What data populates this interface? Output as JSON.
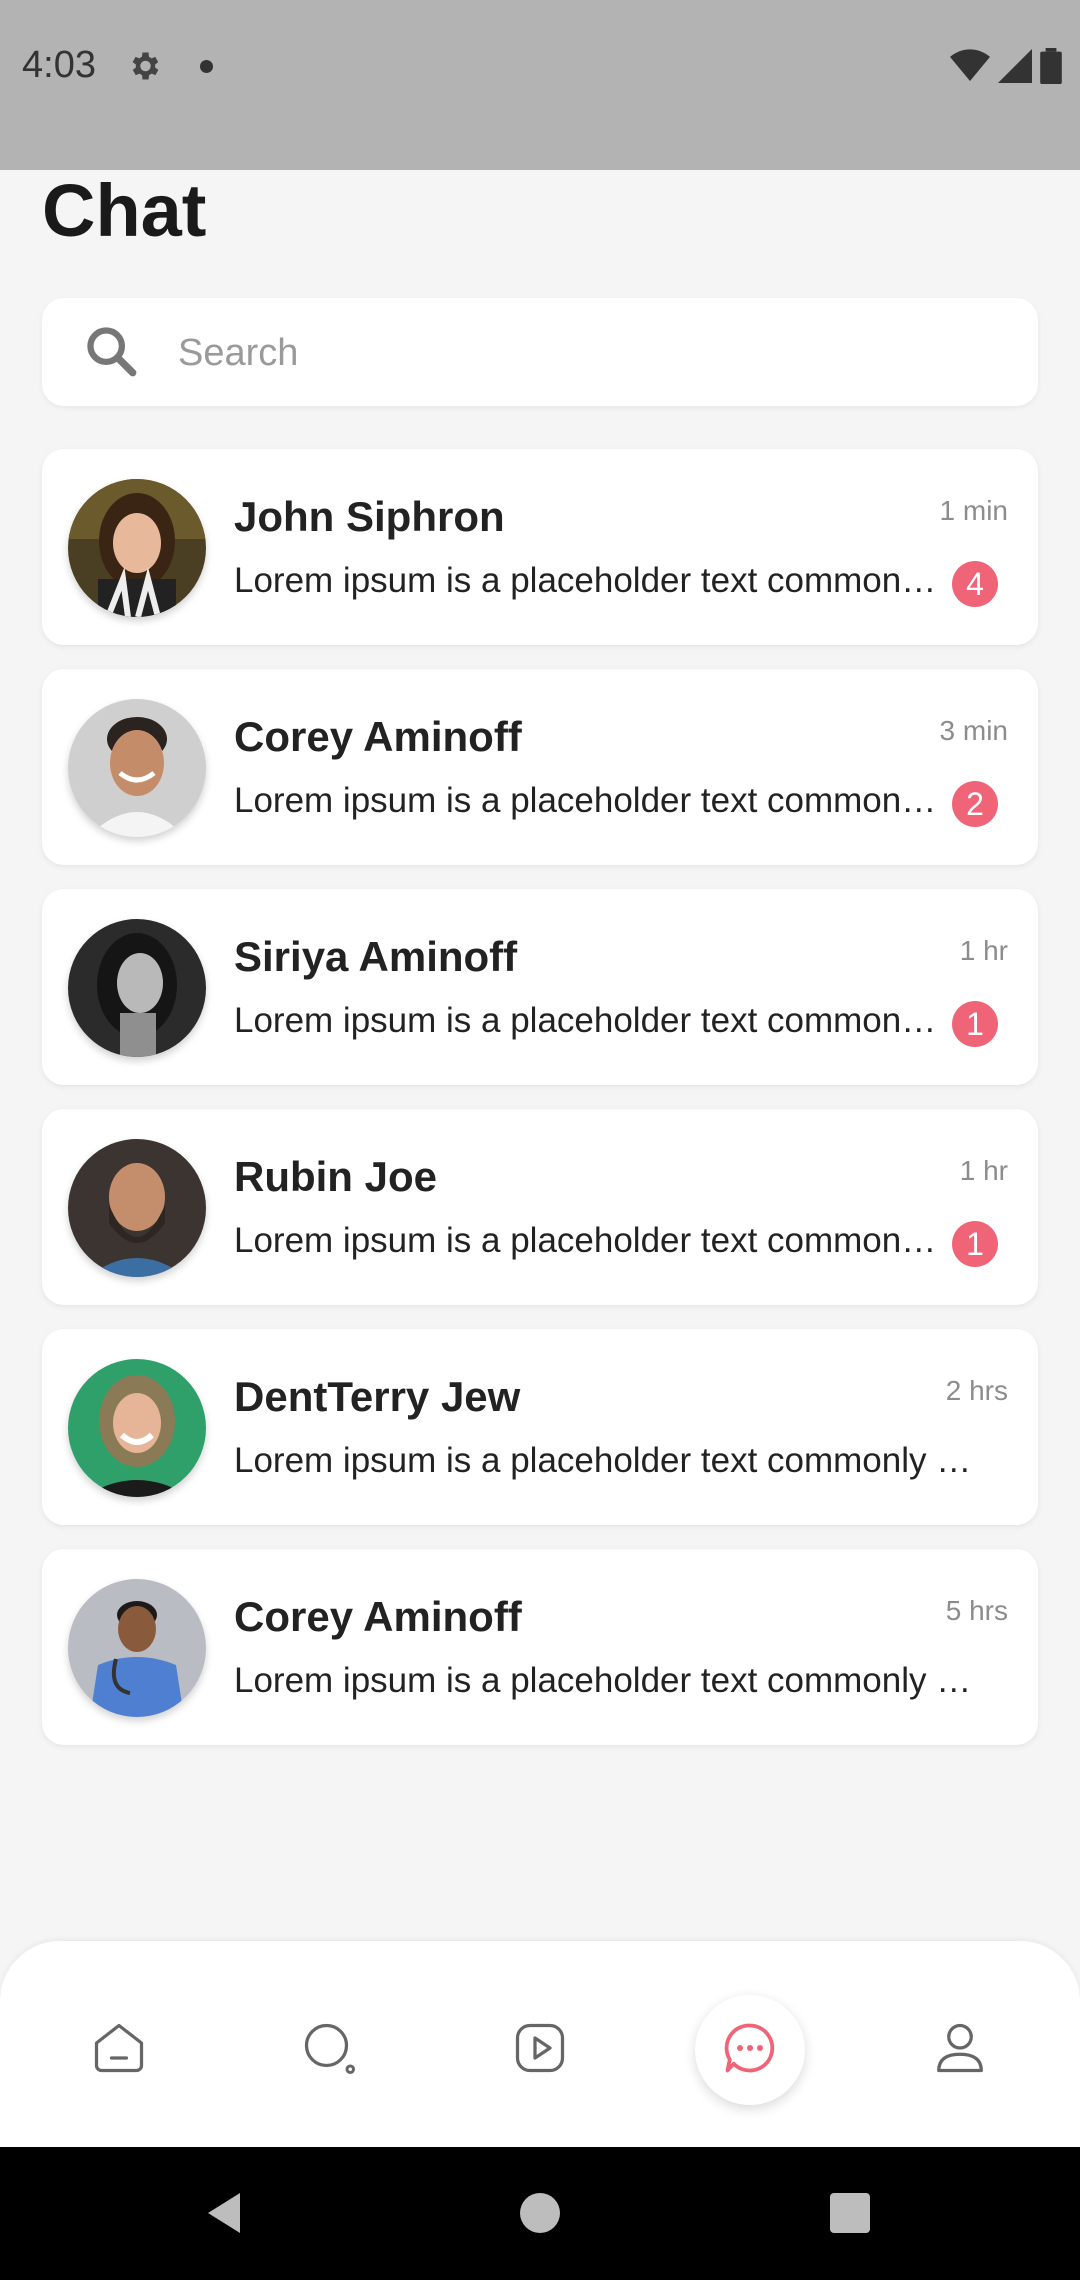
{
  "status": {
    "time": "4:03"
  },
  "page": {
    "title": "Chat"
  },
  "search": {
    "placeholder": "Search",
    "value": ""
  },
  "chats": [
    {
      "name": "John Siphron",
      "time": "1 min",
      "preview": "Lorem ipsum is a placeholder text commonly used",
      "unread": "4"
    },
    {
      "name": "Corey Aminoff",
      "time": "3 min",
      "preview": "Lorem ipsum is a placeholder text commonly used",
      "unread": "2"
    },
    {
      "name": "Siriya Aminoff",
      "time": "1 hr",
      "preview": "Lorem ipsum is a placeholder text commonly used",
      "unread": "1"
    },
    {
      "name": "Rubin Joe",
      "time": "1 hr",
      "preview": "Lorem ipsum is a placeholder text commonly used",
      "unread": "1"
    },
    {
      "name": "DentTerry Jew",
      "time": "2 hrs",
      "preview": "Lorem ipsum is a placeholder text commonly used"
    },
    {
      "name": "Corey Aminoff",
      "time": "5 hrs",
      "preview": "Lorem ipsum is a placeholder text commonly used"
    }
  ],
  "bottom_nav": {
    "items": [
      {
        "icon": "home-icon"
      },
      {
        "icon": "search-icon"
      },
      {
        "icon": "play-icon"
      },
      {
        "icon": "chat-icon",
        "active": true
      },
      {
        "icon": "profile-icon"
      }
    ],
    "accent": "#f06478"
  }
}
